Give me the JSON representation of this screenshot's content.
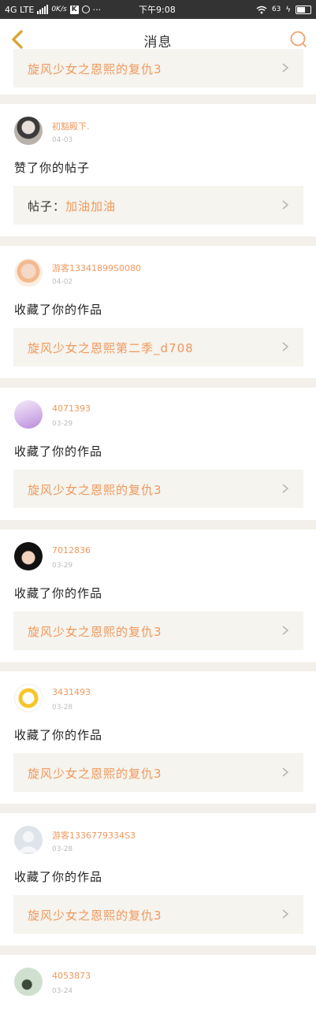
{
  "status_bar": {
    "network": "4G LTE",
    "speed": "0K/s",
    "k_icon": "K",
    "dots": "···",
    "time": "下午9:08",
    "battery_percent": "63"
  },
  "header": {
    "title": "消息"
  },
  "top_partial": {
    "text": "旋风少女之恩熙的复仇3"
  },
  "messages": [
    {
      "user": "初豁殿下.",
      "date": "04-03",
      "action": "赞了你的帖子",
      "box_label": "帖子：",
      "box_text": "加油加油"
    },
    {
      "user": "游客13341899S0080",
      "date": "04-02",
      "action": "收藏了你的作品",
      "box_label": "",
      "box_text": "旋风少女之恩熙第二季_d708"
    },
    {
      "user": "4071393",
      "date": "03-29",
      "action": "收藏了你的作品",
      "box_label": "",
      "box_text": "旋风少女之恩熙的复仇3"
    },
    {
      "user": "7012836",
      "date": "03-29",
      "action": "收藏了你的作品",
      "box_label": "",
      "box_text": "旋风少女之恩熙的复仇3"
    },
    {
      "user": "3431493",
      "date": "03-28",
      "action": "收藏了你的作品",
      "box_label": "",
      "box_text": "旋风少女之恩熙的复仇3"
    },
    {
      "user": "游客1336779334S3",
      "date": "03-28",
      "action": "收藏了你的作品",
      "box_label": "",
      "box_text": "旋风少女之恩熙的复仇3"
    },
    {
      "user": "4053873",
      "date": "03-24"
    }
  ],
  "colors": {
    "accent": "#f0985d",
    "back_arrow": "#d9a735"
  },
  "icons": {
    "back": "back-arrow-icon",
    "search": "search-icon",
    "chevron": "chevron-right-icon"
  }
}
